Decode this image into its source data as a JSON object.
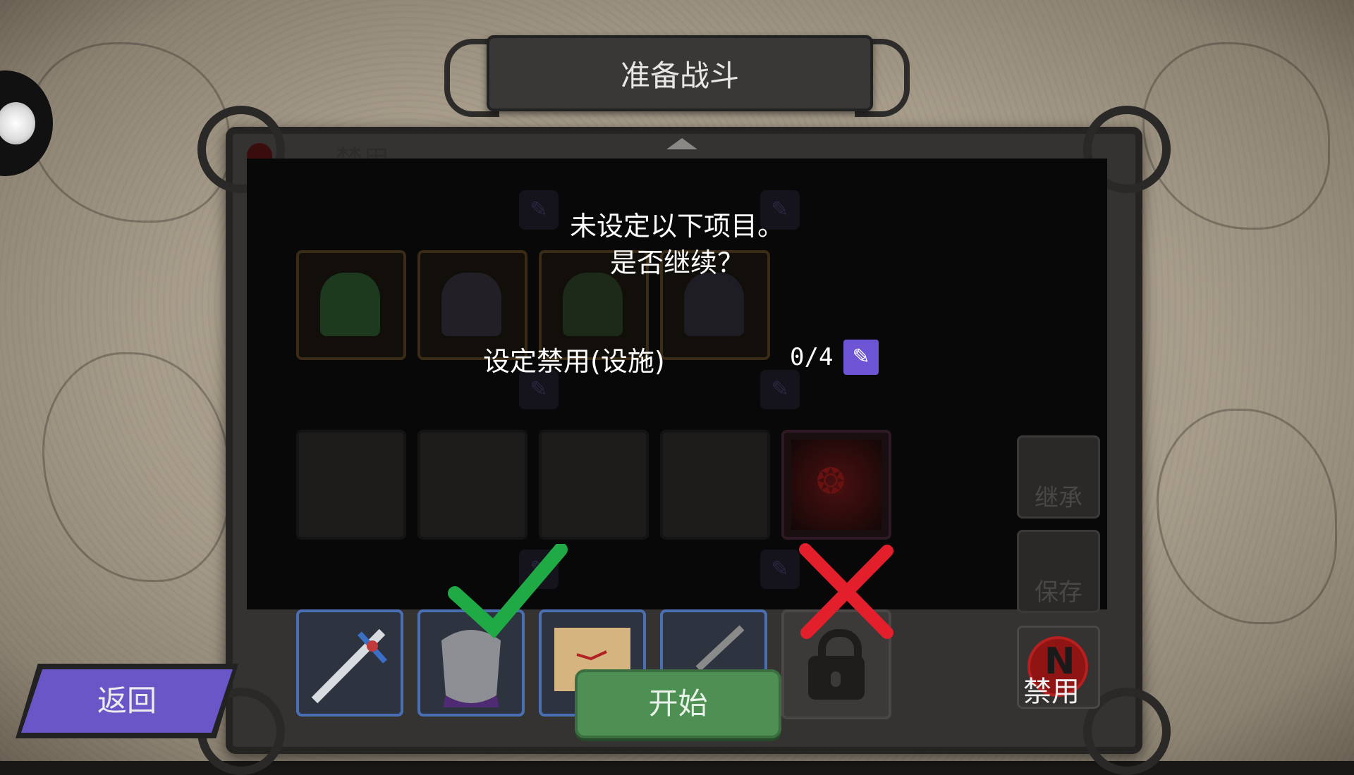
{
  "screen_title": "准备战斗",
  "ban_panel": {
    "header_label": "禁用"
  },
  "dialog": {
    "line1": "未设定以下项目。",
    "line2": "是否继续？",
    "item_label": "设定禁用(设施)",
    "item_count": "0/4"
  },
  "side_options": {
    "inherit_label": "继承",
    "save_label": "保存",
    "ban_label": "禁用",
    "ban_icon_letter": "N"
  },
  "buttons": {
    "back_label": "返回",
    "start_label": "开始",
    "confirm_icon": "check-icon",
    "cancel_icon": "x-icon"
  },
  "equipment": [
    "sword",
    "armor",
    "map-scroll",
    "dagger",
    "locked"
  ],
  "colors": {
    "start": "#4e8f53",
    "back": "#6b56c7",
    "edit": "#6d55d6",
    "check": "#1faa45",
    "cross": "#e21f2a",
    "ban": "#8f1515"
  }
}
